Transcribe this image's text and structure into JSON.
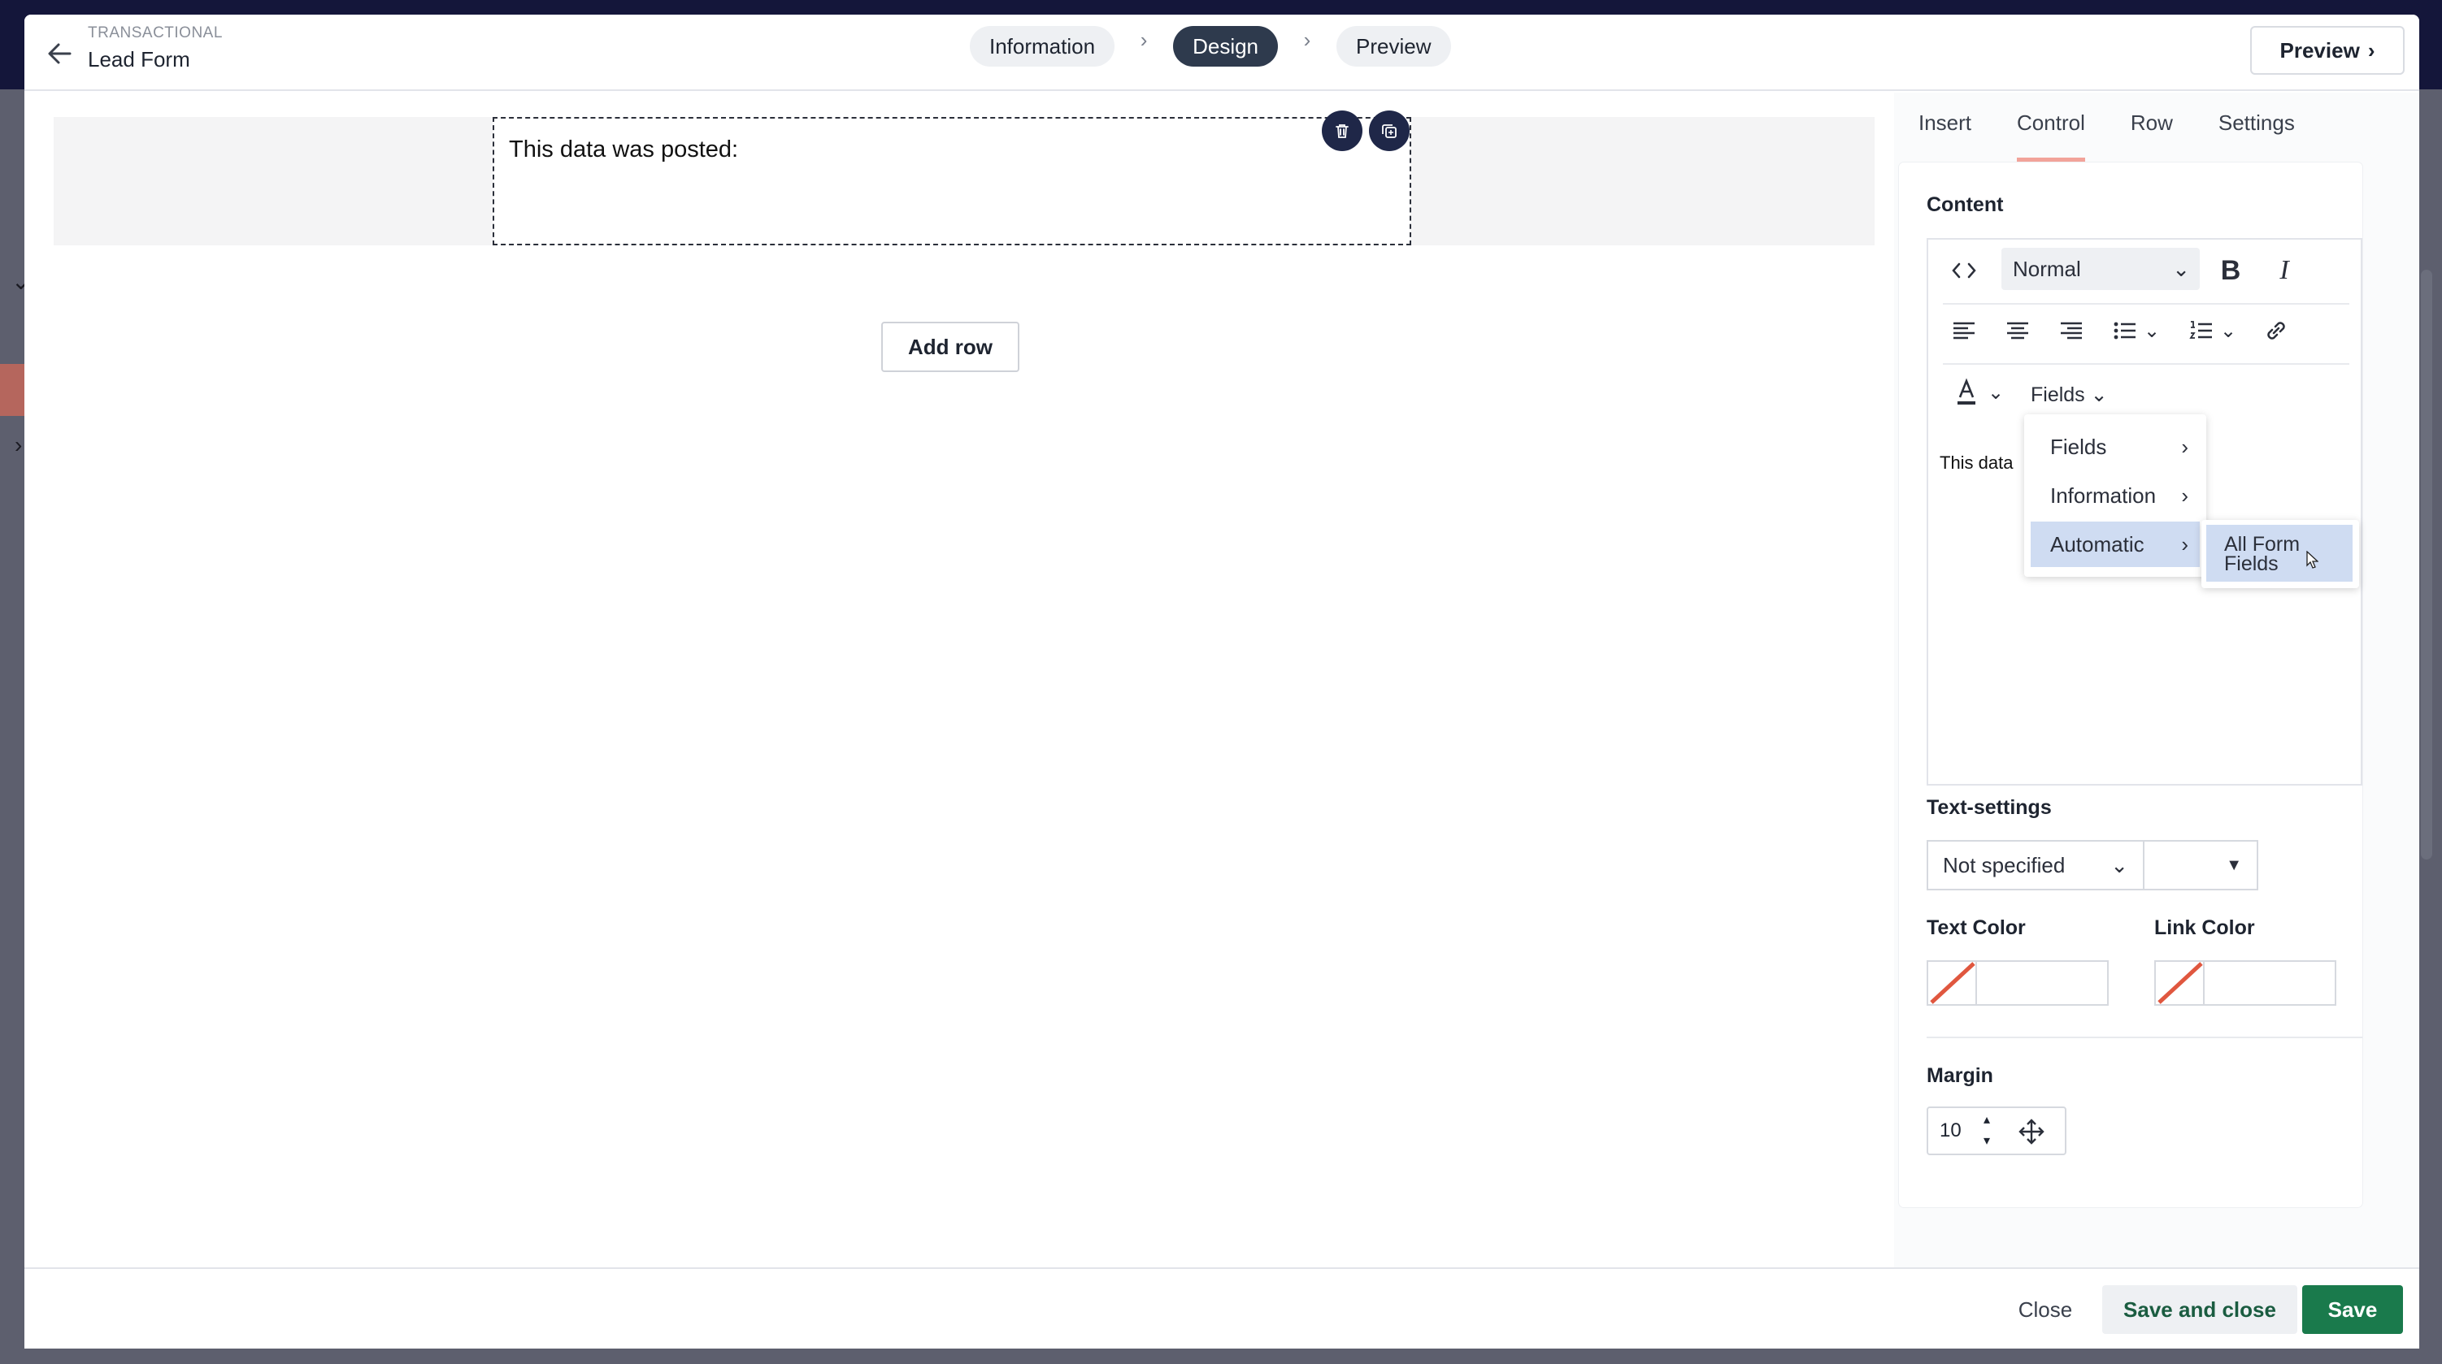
{
  "header": {
    "category": "TRANSACTIONAL",
    "title": "Lead Form",
    "preview_button": "Preview"
  },
  "steps": [
    "Information",
    "Design",
    "Preview"
  ],
  "active_step": "Design",
  "canvas": {
    "text_block": "This data was posted:",
    "add_row": "Add row"
  },
  "panel": {
    "tabs": [
      "Insert",
      "Control",
      "Row",
      "Settings"
    ],
    "active_tab": "Control",
    "content_label": "Content",
    "format_select": "Normal",
    "fields_button": "Fields",
    "editor_text": "This data",
    "menu_items": [
      "Fields",
      "Information",
      "Automatic"
    ],
    "submenu_item": "All Form Fields",
    "text_settings_label": "Text-settings",
    "text_settings_value": "Not specified",
    "text_color_label": "Text Color",
    "link_color_label": "Link Color",
    "margin_label": "Margin",
    "margin_value": "10"
  },
  "footer": {
    "close": "Close",
    "save_and_close": "Save and close",
    "save": "Save"
  },
  "colors": {
    "accent_green": "#1a7a4c",
    "dark_navy": "#2e3a4d",
    "tab_underline": "#f2a39a",
    "menu_highlight": "#cfdcf2",
    "no_color_slash": "#e0573f"
  }
}
